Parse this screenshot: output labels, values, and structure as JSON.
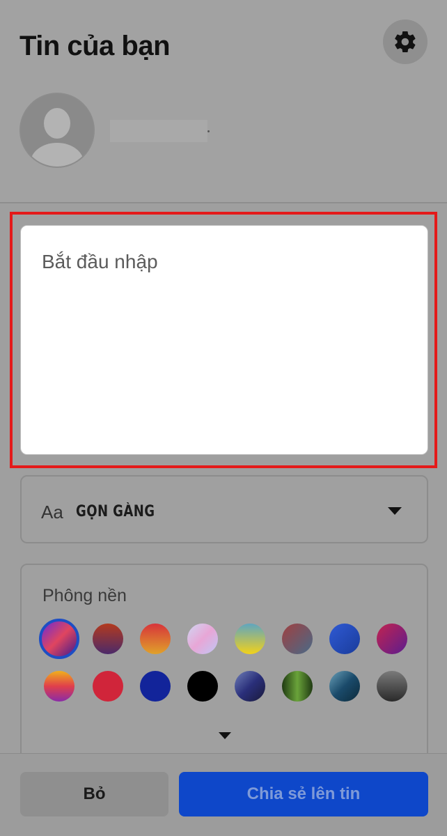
{
  "header": {
    "title": "Tin của bạn",
    "settings_icon": "gear-icon"
  },
  "profile": {
    "avatar_icon": "default-avatar-icon"
  },
  "composer": {
    "placeholder": "Bắt đầu nhập"
  },
  "font": {
    "aa_label": "Aa",
    "selected": "GỌN GÀNG"
  },
  "background": {
    "label": "Phông nền",
    "swatches": [
      "linear-gradient(135deg,#6b2bd6,#e0455f,#3d1a8f)",
      "linear-gradient(180deg,#b33a1e,#4b2a6a)",
      "linear-gradient(180deg,#d7343b,#e0a22a)",
      "linear-gradient(135deg,#cfd6f2,#e8a6d6,#bfc7f5)",
      "linear-gradient(180deg,#5fa5c0,#f2d21a)",
      "linear-gradient(135deg,#a04040,#486a88)",
      "linear-gradient(135deg,#2f5ad4,#1a3c9b)",
      "linear-gradient(135deg,#c2234f,#5b1d8f)",
      "linear-gradient(180deg,#f0b01c,#e03f4b,#8a2ba8)",
      "#d0253a",
      "#12249a",
      "#000000",
      "linear-gradient(135deg,#6f7fb8,#2a2f7a,#1a1a3a)",
      "linear-gradient(90deg,#1f3a12,#6aa33a,#1f3a12)",
      "linear-gradient(135deg,#6aa0b8,#1a4a6a,#0c2a3a)",
      "linear-gradient(180deg,#7a7a7a,#2a2a2a)"
    ]
  },
  "footer": {
    "cancel_label": "Bỏ",
    "share_label": "Chia sẻ lên tin"
  }
}
